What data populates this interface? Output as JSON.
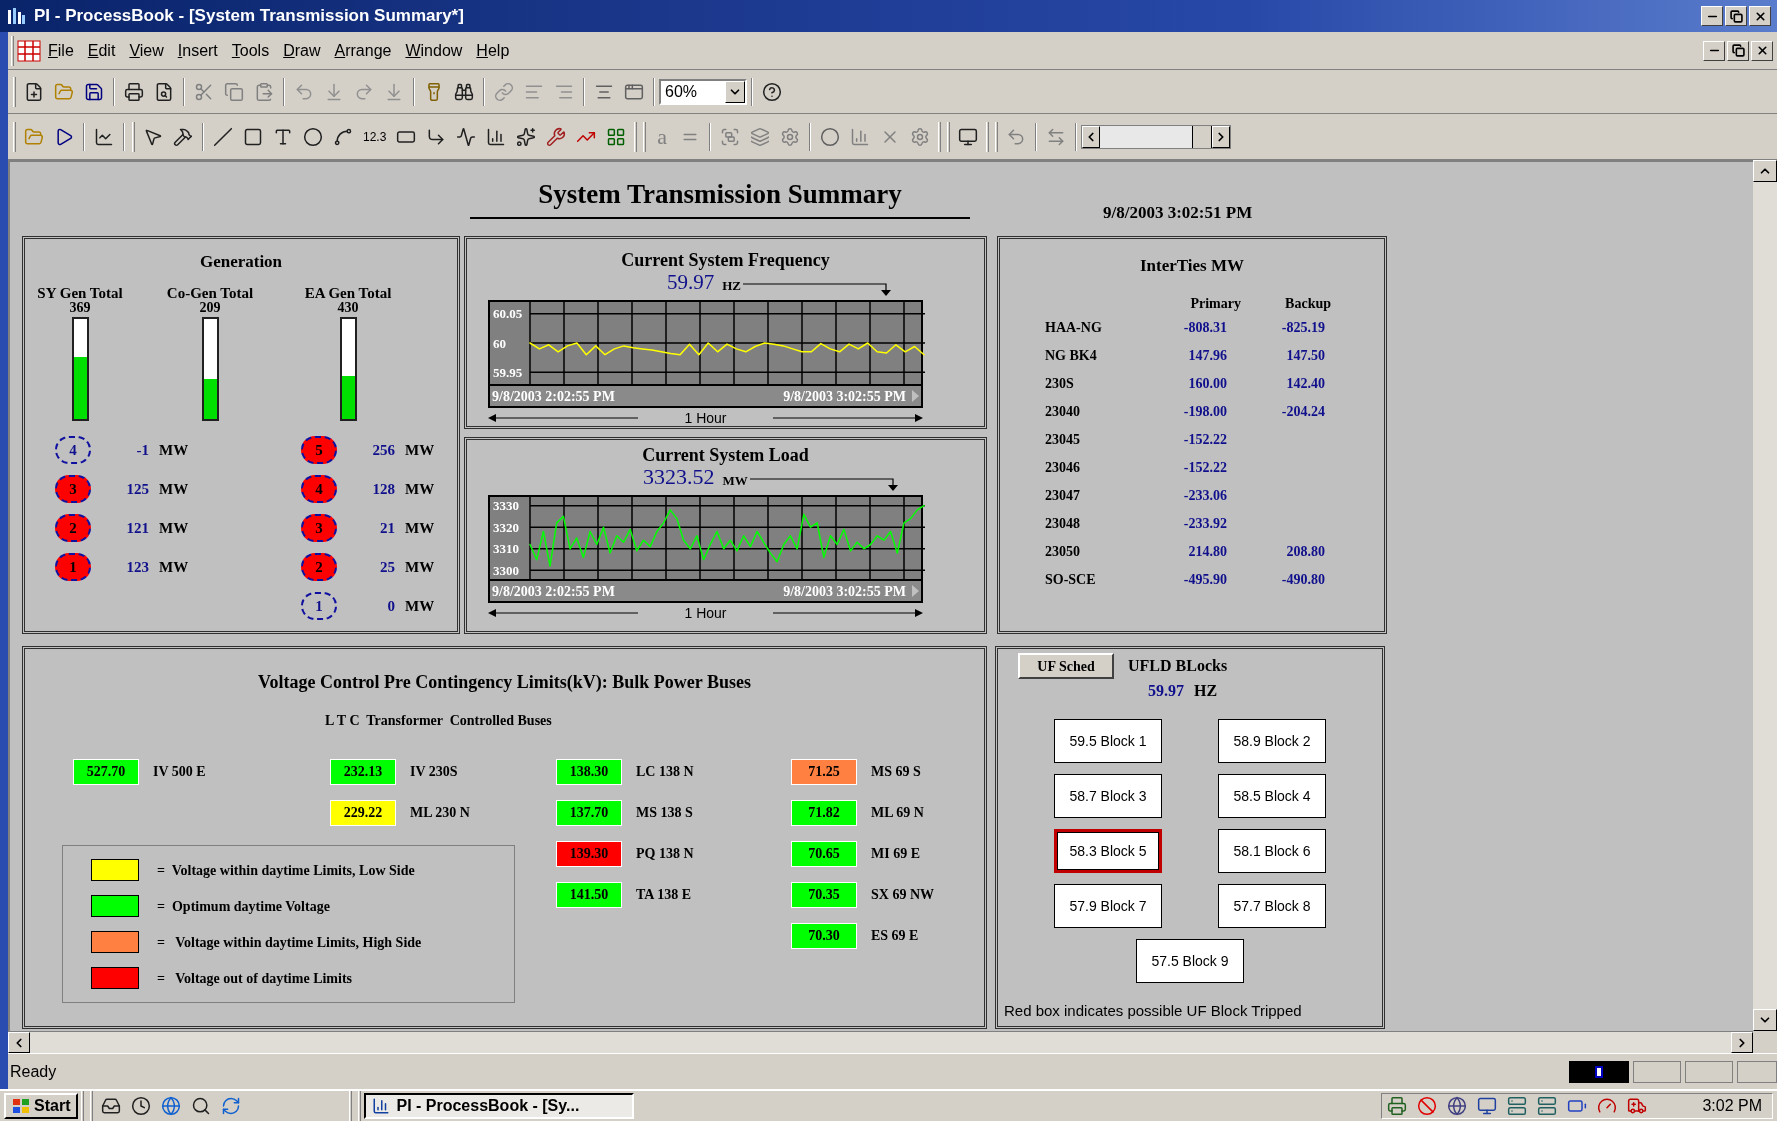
{
  "window": {
    "title": "PI - ProcessBook - [System Transmission Summary*]"
  },
  "menu": [
    "File",
    "Edit",
    "View",
    "Insert",
    "Tools",
    "Draw",
    "Arrange",
    "Window",
    "Help"
  ],
  "toolbar": {
    "zoom": "60%",
    "value_tool": "12.3",
    "text_tool": "a",
    "slider": {
      "level": 1
    }
  },
  "display": {
    "title": "System Transmission Summary",
    "timestamp": "9/8/2003 3:02:51 PM"
  },
  "generation": {
    "title": "Generation",
    "meters": [
      {
        "label": "SY Gen Total",
        "value": "369",
        "level": 0.62
      },
      {
        "label": "Co-Gen Total",
        "value": "209",
        "level": 0.4
      },
      {
        "label": "EA Gen Total",
        "value": "430",
        "level": 0.43
      }
    ],
    "unit_columns": [
      [
        {
          "unit": "4",
          "on": false,
          "value": "-1",
          "suffix": "MW"
        },
        {
          "unit": "3",
          "on": true,
          "value": "125",
          "suffix": "MW"
        },
        {
          "unit": "2",
          "on": true,
          "value": "121",
          "suffix": "MW"
        },
        {
          "unit": "1",
          "on": true,
          "value": "123",
          "suffix": "MW"
        }
      ],
      [
        {
          "unit": "5",
          "on": true,
          "value": "256",
          "suffix": "MW"
        },
        {
          "unit": "4",
          "on": true,
          "value": "128",
          "suffix": "MW"
        },
        {
          "unit": "3",
          "on": true,
          "value": "21",
          "suffix": "MW"
        },
        {
          "unit": "2",
          "on": true,
          "value": "25",
          "suffix": "MW"
        },
        {
          "unit": "1",
          "on": false,
          "value": "0",
          "suffix": "MW"
        }
      ]
    ]
  },
  "frequency": {
    "title": "Current System Frequency",
    "value": "59.97",
    "unit": "HZ",
    "start": "9/8/2003 2:02:55 PM",
    "end": "9/8/2003 3:02:55 PM",
    "span": "1 Hour",
    "chart_data": {
      "type": "line",
      "grid": true,
      "ylim": [
        59.93,
        60.07
      ],
      "yticks": [
        60.05,
        60,
        59.95
      ],
      "series": [
        {
          "color": "#ffff00",
          "values": [
            60.0,
            59.99,
            59.997,
            59.985,
            59.995,
            60.0,
            59.98,
            59.995,
            59.98,
            59.99,
            59.995,
            59.992,
            59.99,
            59.988,
            59.985,
            59.982,
            59.98,
            59.998,
            59.98,
            60.0,
            59.985,
            59.998,
            59.99,
            59.985,
            59.994,
            60.0,
            59.998,
            59.995,
            59.99,
            59.985,
            59.985,
            59.999,
            59.99,
            59.985,
            59.998,
            59.99,
            60.0,
            59.985,
            59.983,
            59.997,
            59.985,
            59.994,
            59.98
          ]
        }
      ]
    }
  },
  "load": {
    "title": "Current System Load",
    "value": "3323.52",
    "unit": "MW",
    "start": "9/8/2003 2:02:55 PM",
    "end": "9/8/2003 3:02:55 PM",
    "span": "1 Hour",
    "chart_data": {
      "type": "line",
      "grid": true,
      "ylim": [
        3296,
        3334
      ],
      "yticks": [
        3330,
        3320,
        3310,
        3300
      ],
      "series": [
        {
          "color": "#00ff00",
          "values": [
            3312,
            3305,
            3318,
            3302,
            3322,
            3325,
            3310,
            3315,
            3306,
            3318,
            3312,
            3320,
            3308,
            3316,
            3313,
            3319,
            3309,
            3314,
            3311,
            3318,
            3322,
            3328,
            3324,
            3314,
            3310,
            3316,
            3305,
            3312,
            3318,
            3310,
            3314,
            3309,
            3316,
            3311,
            3318,
            3313,
            3308,
            3304,
            3312,
            3316,
            3310,
            3326,
            3320,
            3322,
            3306,
            3316,
            3312,
            3319,
            3309,
            3313,
            3310,
            3312,
            3316,
            3314,
            3318,
            3308,
            3322,
            3324,
            3328,
            3330
          ]
        }
      ]
    }
  },
  "interties": {
    "title": "InterTies MW",
    "columns": [
      "Primary",
      "Backup"
    ],
    "rows": [
      {
        "name": "HAA-NG",
        "primary": "-808.31",
        "backup": "-825.19"
      },
      {
        "name": "NG BK4",
        "primary": "147.96",
        "backup": "147.50"
      },
      {
        "name": "230S",
        "primary": "160.00",
        "backup": "142.40"
      },
      {
        "name": "23040",
        "primary": "-198.00",
        "backup": "-204.24"
      },
      {
        "name": "23045",
        "primary": "-152.22"
      },
      {
        "name": "23046",
        "primary": "-152.22"
      },
      {
        "name": "23047",
        "primary": "-233.06"
      },
      {
        "name": "23048",
        "primary": "-233.92"
      },
      {
        "name": "23050",
        "primary": "214.80",
        "backup": "208.80"
      },
      {
        "name": "SO-SCE",
        "primary": "-495.90",
        "backup": "-490.80"
      }
    ]
  },
  "voltage": {
    "title": "Voltage Control Pre Contingency Limits(kV): Bulk Power Buses",
    "subtitle": "L T C  Transformer  Controlled Buses",
    "columns": [
      [
        {
          "value": "527.70",
          "name": "IV 500 E",
          "color": "#00ff00"
        }
      ],
      [
        {
          "value": "232.13",
          "name": "IV 230S",
          "color": "#00ff00"
        },
        {
          "value": "229.22",
          "name": "ML 230 N",
          "color": "#ffff00"
        }
      ],
      [
        {
          "value": "138.30",
          "name": "LC 138 N",
          "color": "#00ff00"
        },
        {
          "value": "137.70",
          "name": "MS 138 S",
          "color": "#00ff00"
        },
        {
          "value": "139.30",
          "name": "PQ 138 N",
          "color": "#ff0000"
        },
        {
          "value": "141.50",
          "name": "TA 138 E",
          "color": "#00ff00"
        }
      ],
      [
        {
          "value": "71.25",
          "name": "MS 69 S",
          "color": "#ff8040"
        },
        {
          "value": "71.82",
          "name": "ML 69 N",
          "color": "#00ff00"
        },
        {
          "value": "70.65",
          "name": "MI 69 E",
          "color": "#00ff00"
        },
        {
          "value": "70.35",
          "name": "SX 69 NW",
          "color": "#00ff00"
        },
        {
          "value": "70.30",
          "name": "ES 69 E",
          "color": "#00ff00"
        }
      ]
    ],
    "legend": [
      {
        "color": "#ffff00",
        "text": "=  Voltage within daytime Limits, Low Side"
      },
      {
        "color": "#00ff00",
        "text": "=  Optimum daytime Voltage"
      },
      {
        "color": "#ff8040",
        "text": "=   Voltage within daytime Limits, High Side"
      },
      {
        "color": "#ff0000",
        "text": "=   Voltage out of daytime Limits"
      }
    ]
  },
  "uf": {
    "button": "UF Sched",
    "title": "UFLD BLocks",
    "value": "59.97",
    "unit": "HZ",
    "blocks": [
      {
        "label": "59.5 Block 1",
        "tripped": false
      },
      {
        "label": "58.9 Block 2",
        "tripped": false
      },
      {
        "label": "58.7 Block 3",
        "tripped": false
      },
      {
        "label": "58.5 Block 4",
        "tripped": false
      },
      {
        "label": "58.3 Block 5",
        "tripped": true
      },
      {
        "label": "58.1 Block 6",
        "tripped": false
      },
      {
        "label": "57.9 Block 7",
        "tripped": false
      },
      {
        "label": "57.7 Block 8",
        "tripped": false
      },
      {
        "label": "57.5 Block 9",
        "tripped": false
      }
    ],
    "note": "Red box indicates possible UF Block Tripped"
  },
  "status_bar": {
    "text": "Ready"
  },
  "taskbar": {
    "start": "Start",
    "task": "PI - ProcessBook - [Sy...",
    "clock": "3:02 PM"
  }
}
